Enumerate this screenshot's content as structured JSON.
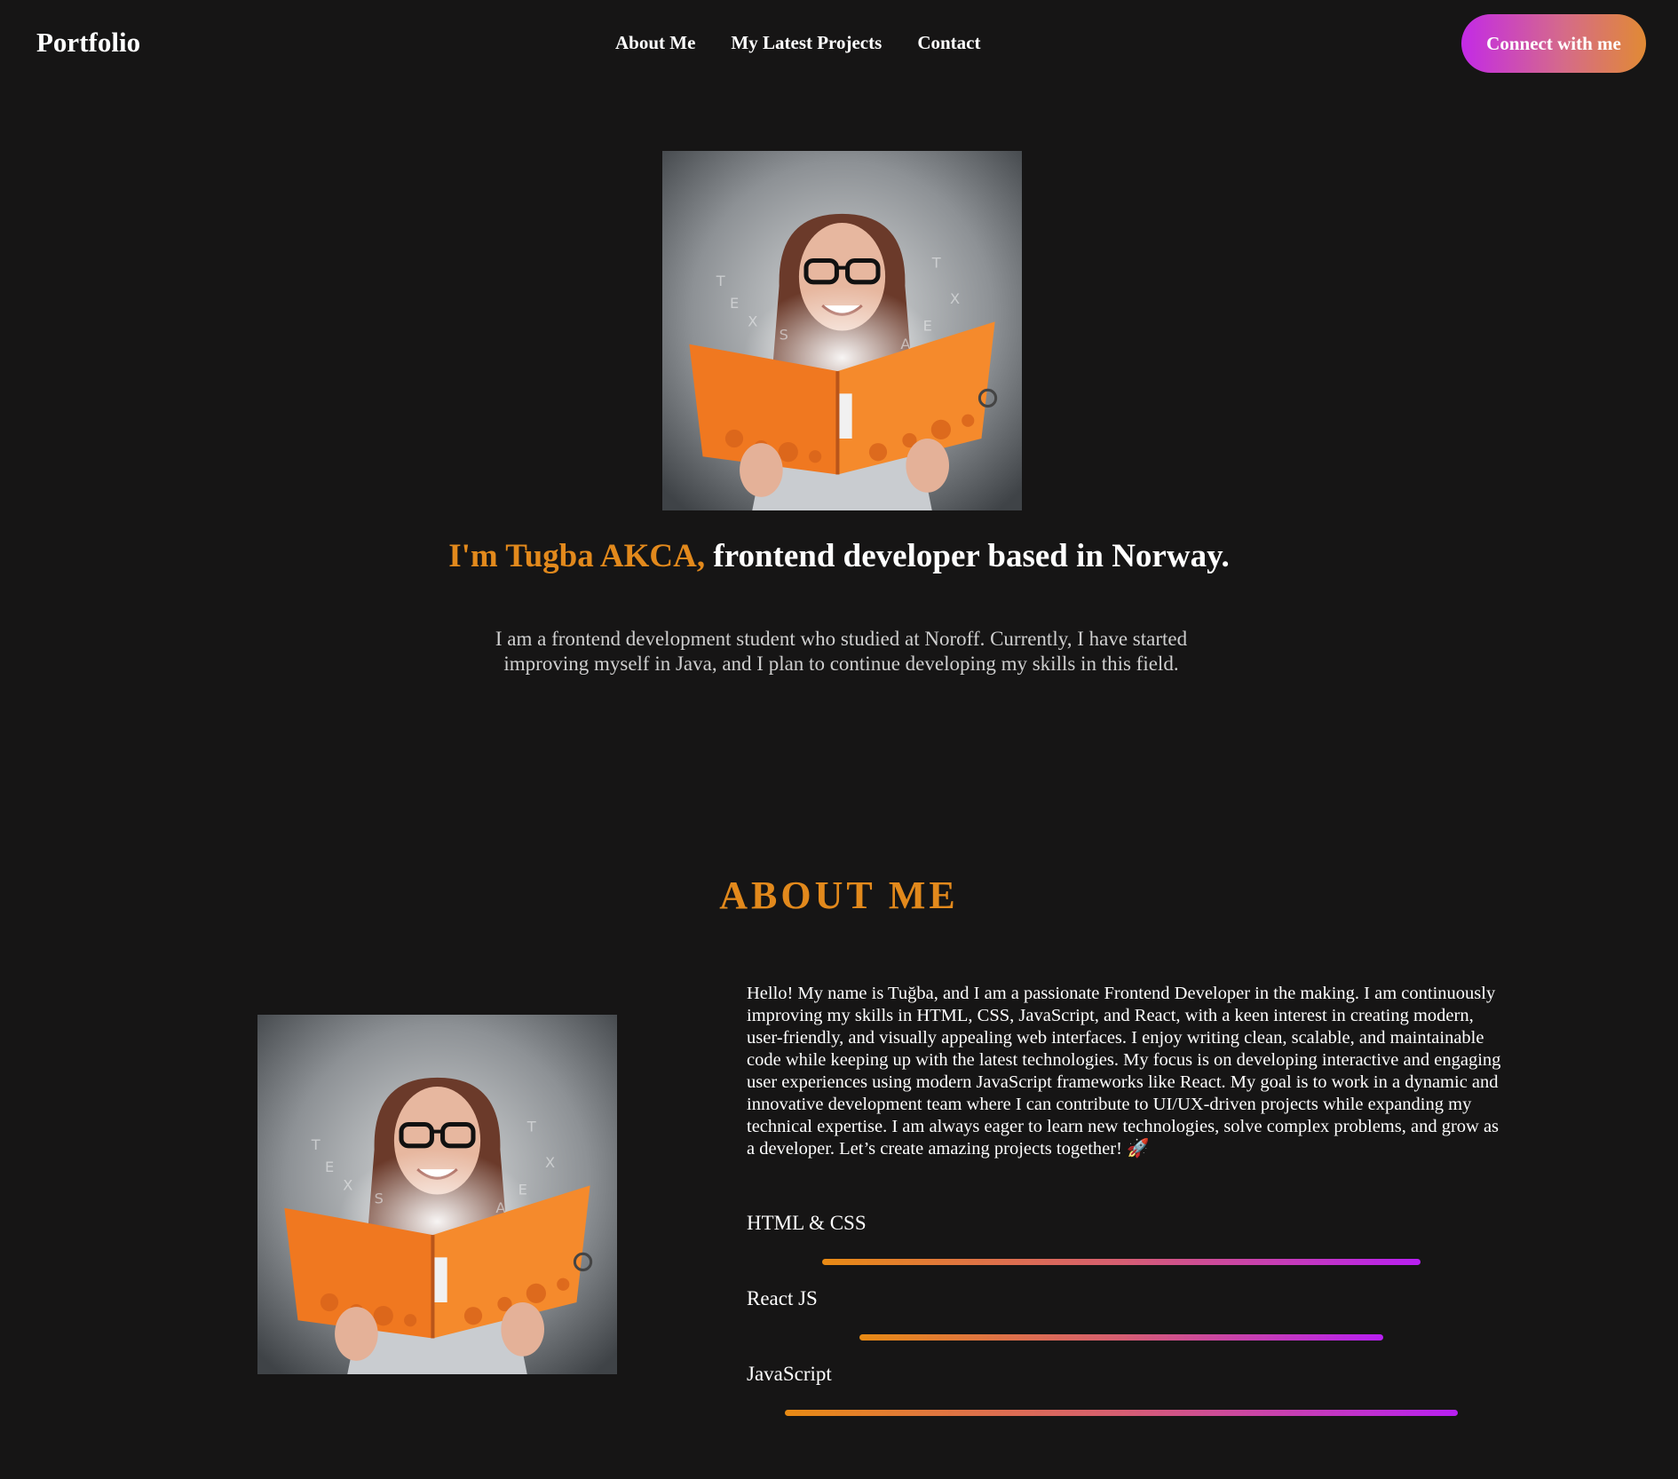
{
  "nav": {
    "brand": "Portfolio",
    "links": [
      "About Me",
      "My Latest Projects",
      "Contact"
    ],
    "cta": "Connect with me"
  },
  "hero": {
    "image_alt": "woman reading orange book",
    "title_accent": "I'm Tugba AKCA,",
    "title_rest": " frontend developer based in Norway.",
    "description": "I am a frontend development student who studied at Noroff. Currently, I have started improving myself in Java, and I plan to continue developing my skills in this field."
  },
  "about": {
    "heading": "ABOUT ME",
    "text": "Hello! My name is Tuğba, and I am a passionate Frontend Developer in the making. I am continuously improving my skills in HTML, CSS, JavaScript, and React, with a keen interest in creating modern, user-friendly, and visually appealing web interfaces. I enjoy writing clean, scalable, and maintainable code while keeping up with the latest technologies. My focus is on developing interactive and engaging user experiences using modern JavaScript frameworks like React. My goal is to work in a dynamic and innovative development team where I can contribute to UI/UX-driven projects while expanding my technical expertise. I am always eager to learn new technologies, solve complex problems, and grow as a developer. Let’s create amazing projects together! 🚀",
    "skills": [
      {
        "label": "HTML & CSS",
        "level": 0.8
      },
      {
        "label": "React JS",
        "level": 0.7
      },
      {
        "label": "JavaScript",
        "level": 0.9
      }
    ]
  },
  "colors": {
    "background": "#161515",
    "accent": "#e2891c",
    "gradient_start": "#e88a14",
    "gradient_end": "#b81ff2"
  }
}
